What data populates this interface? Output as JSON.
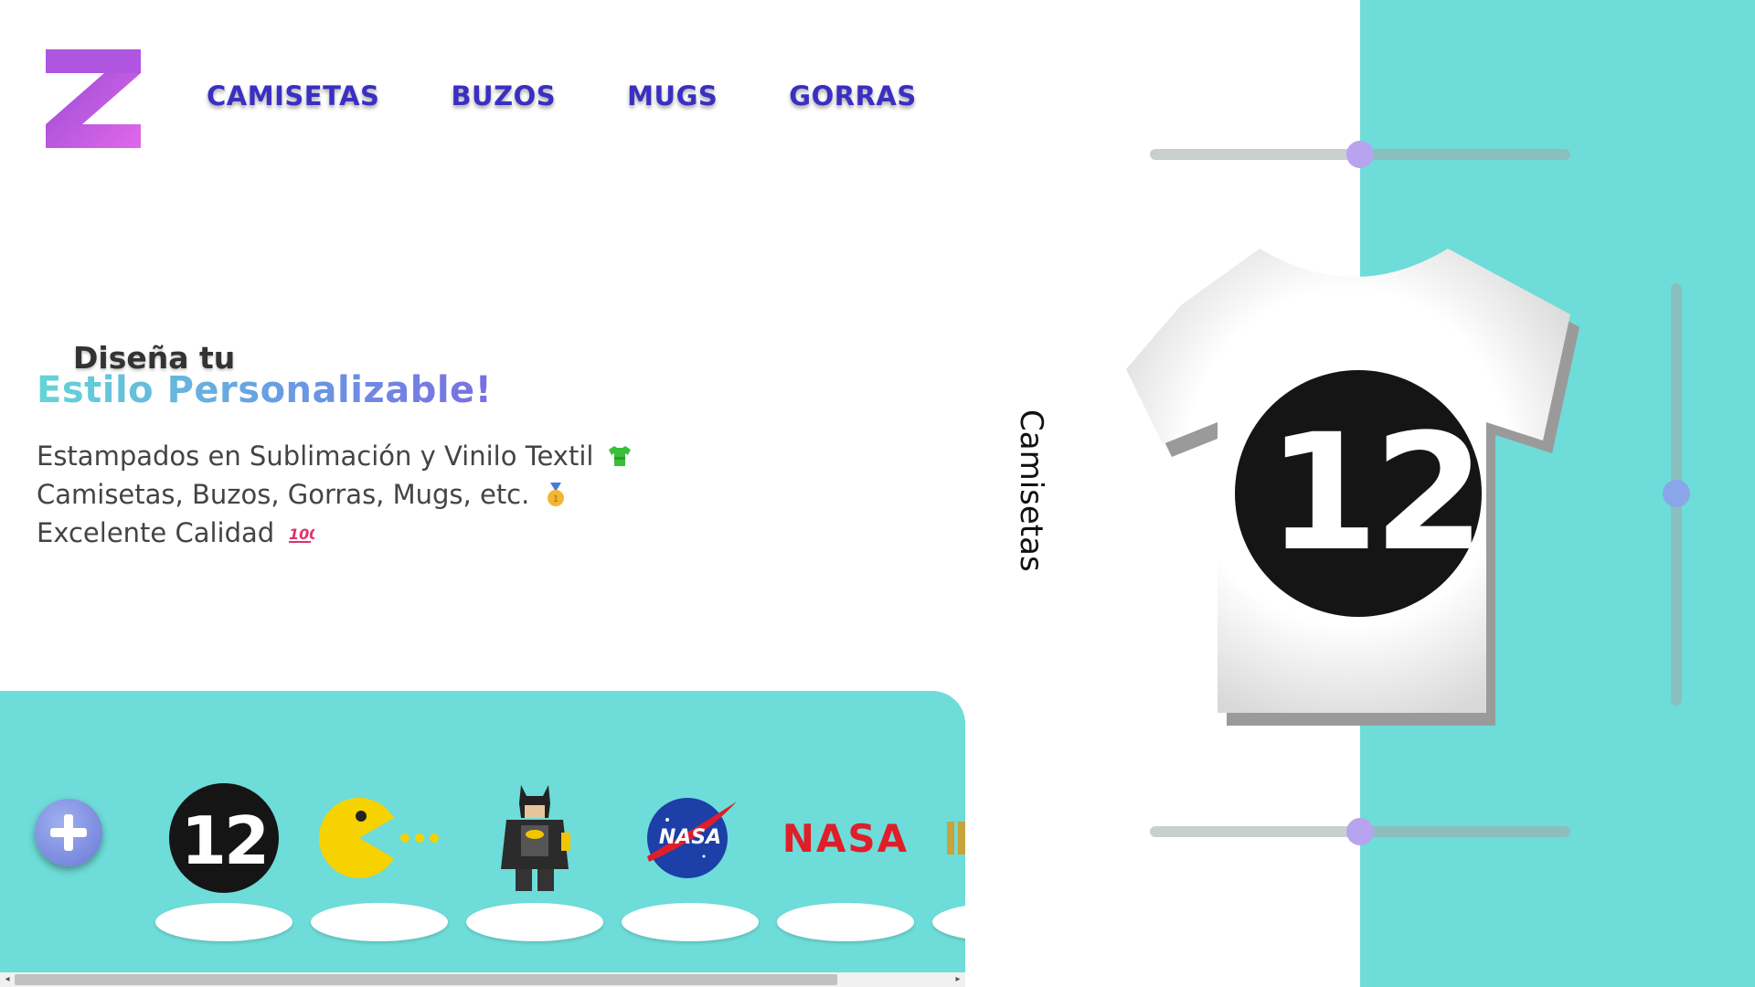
{
  "nav": {
    "items": [
      "CAMISETAS",
      "BUZOS",
      "MUGS",
      "GORRAS"
    ]
  },
  "hero": {
    "small": "Diseña tu",
    "big": "Estilo Personalizable!",
    "lines": [
      "Estampados en Sublimación y Vinilo Textil",
      "Camisetas, Buzos, Gorras, Mugs, etc.",
      "Excelente Calidad"
    ],
    "emojis": [
      "tshirt-emoji",
      "medal-emoji",
      "hundred-points-emoji"
    ]
  },
  "vertical_label": "Camisetas",
  "shirt_print": "12",
  "gallery": {
    "add_icon": "plus-icon",
    "items": [
      {
        "name": "number-12-design",
        "text": "12"
      },
      {
        "name": "pacman-design",
        "text": ""
      },
      {
        "name": "lego-batman-design",
        "text": ""
      },
      {
        "name": "nasa-meatball-design",
        "text": "NASA"
      },
      {
        "name": "nasa-worm-design",
        "text": "NASA"
      }
    ]
  },
  "colors": {
    "teal": "#6edcd8",
    "nav": "#3a2fc2",
    "knob": "#b7a3ee"
  },
  "sliders": {
    "top_horizontal": 0.5,
    "bottom_horizontal": 0.5,
    "vertical": 0.5
  }
}
